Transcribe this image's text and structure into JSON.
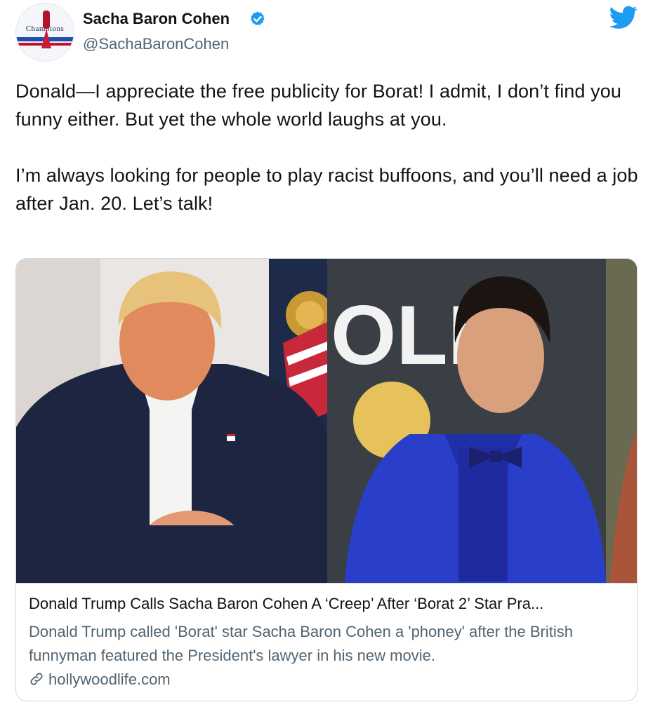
{
  "author": {
    "display_name": "Sacha Baron Cohen",
    "handle": "@SachaBaronCohen",
    "avatar_text": "Champions",
    "avatar_icon": "avatar-figure-skater",
    "verified_icon": "verified-badge-icon"
  },
  "brand": {
    "icon": "twitter-bird-icon",
    "color": "#1d9bf0"
  },
  "tweet": {
    "paragraph1": "Donald—I appreciate the free publicity for Borat! I admit, I don’t find you funny either. But yet the whole world laughs at you.",
    "paragraph2": "I’m always looking for people to play racist buffoons, and you’ll need a job after Jan. 20. Let’s talk!"
  },
  "card": {
    "image_left": "photo-donald-trump-dark-suit",
    "image_right": "photo-sacha-baron-cohen-blue-tuxedo",
    "image_right_bg_text": "OLD",
    "title": "Donald Trump Calls Sacha Baron Cohen A ‘Creep’ After ‘Borat 2’ Star Pra...",
    "description": "Donald Trump called 'Borat' star Sacha Baron Cohen a 'phoney' after the British funnyman featured the President's lawyer in his new movie.",
    "domain": "hollywoodlife.com",
    "link_icon": "link-icon"
  },
  "colors": {
    "text": "#0f1419",
    "secondary": "#536471",
    "border": "#cfd9de",
    "verified": "#1d9bf0"
  }
}
